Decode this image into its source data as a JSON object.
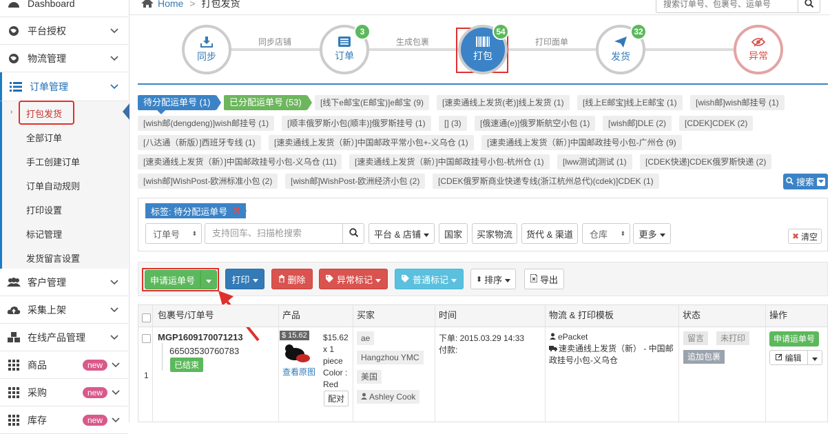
{
  "sidebar": {
    "dashboard": "Dashboard",
    "platform_auth": "平台授权",
    "logistics": "物流管理",
    "order_mgmt": "订单管理",
    "subitems": [
      "打包发货",
      "全部订单",
      "手工创建订单",
      "订单自动规则",
      "打印设置",
      "标记管理",
      "发货留言设置"
    ],
    "customer": "客户管理",
    "collect": "采集上架",
    "online_product": "在线产品管理",
    "goods": "商品",
    "purchase": "采购",
    "stock": "库存",
    "new_badge": "new"
  },
  "breadcrumb": {
    "home": "Home",
    "sep": ">",
    "current": "打包发货"
  },
  "top_search": {
    "placeholder": "搜索订单号、包裹号、运单号"
  },
  "steps": {
    "sync": "同步",
    "order": "订单",
    "order_count": "3",
    "pack": "打包",
    "pack_count": "54",
    "ship": "发货",
    "ship_count": "32",
    "abnormal": "异常",
    "sync_store": "同步店铺",
    "gen_package": "生成包裹",
    "print_label": "打印面单"
  },
  "tags": [
    "待分配运单号 (1)",
    "已分配运单号 (53)",
    "[线下e邮宝(E邮宝)]e邮宝 (9)",
    "[速卖通线上发货(老)]线上发货 (1)",
    "[线上E邮宝]线上E邮宝 (1)",
    "[wish邮]wish邮挂号 (1)",
    "[wish邮(dengdeng)]wish邮挂号 (1)",
    "[顺丰俄罗斯小包(顺丰)]俄罗斯挂号 (1)",
    "[] (3)",
    "[俄速通(e)]俄罗斯航空小包 (1)",
    "[wish邮]DLE (2)",
    "[CDEK]CDEK (2)",
    "[八达通（新版）]西班牙专线 (1)",
    "[速卖通线上发货（新）]中国邮政平常小包+-义乌仓 (1)",
    "[速卖通线上发货（新）]中国邮政挂号小包-广州仓 (9)",
    "[速卖通线上发货（新）]中国邮政挂号小包-义乌仓 (11)",
    "[速卖通线上发货（新）]中国邮政挂号小包-杭州仓 (1)",
    "[lww测试]测试 (1)",
    "[CDEK快递]CDEK俄罗斯快递 (2)",
    "[wish邮]WishPost-欧洲标准小包 (2)",
    "[wish邮]WishPost-欧洲经济小包 (2)",
    "[CDEK俄罗斯商业快递专线(浙江杭州总代)(cdek)]CDEK (1)"
  ],
  "search_toggle": "搜索",
  "filter": {
    "label_tag": "标签: 待分配运单号",
    "order_no_select": "订单号",
    "search_placeholder": "支持回车、扫描枪搜索",
    "platform_store": "平台 & 店铺",
    "country": "国家",
    "buyer_logistics": "买家物流",
    "forwarder_channel": "货代 & 渠道",
    "warehouse": "仓库",
    "more": "更多",
    "clear": "清空"
  },
  "actions": {
    "apply_waybill": "申请运单号",
    "print": "打印",
    "delete": "删除",
    "abnormal_mark": "异常标记",
    "normal_mark": "普通标记",
    "sort": "排序",
    "export": "导出"
  },
  "table": {
    "headers": [
      "包裹号/订单号",
      "产品",
      "买家",
      "时间",
      "物流 & 打印模板",
      "状态",
      "操作"
    ],
    "row": {
      "index": "1",
      "package_no": "MGP1609170071213",
      "order_no": "66503530760783",
      "order_status": "已结束",
      "price_badge": "$ 15.62",
      "product_info": [
        "$15.62",
        "x 1",
        "piece",
        "Color :",
        "Red"
      ],
      "view_image": "查看原图",
      "match": "配对",
      "buyer_tags": [
        "ae",
        "Hangzhou YMC",
        "美国",
        "Ashley Cook"
      ],
      "time_order": "下单: 2015.03.29 14:33",
      "time_pay": "付款:",
      "logistics_carrier": "ePacket",
      "logistics_template": "速卖通线上发货（新） - 中国邮政挂号小包-义乌仓",
      "status_tags": [
        "留言",
        "未打印",
        "追加包裹"
      ],
      "op_apply": "申请运单号",
      "op_edit": "编辑"
    }
  },
  "colors": {
    "primary": "#337ab7",
    "success": "#5cb85c",
    "danger": "#d9534f",
    "info": "#5bc0de",
    "red_highlight": "#e0302c"
  }
}
